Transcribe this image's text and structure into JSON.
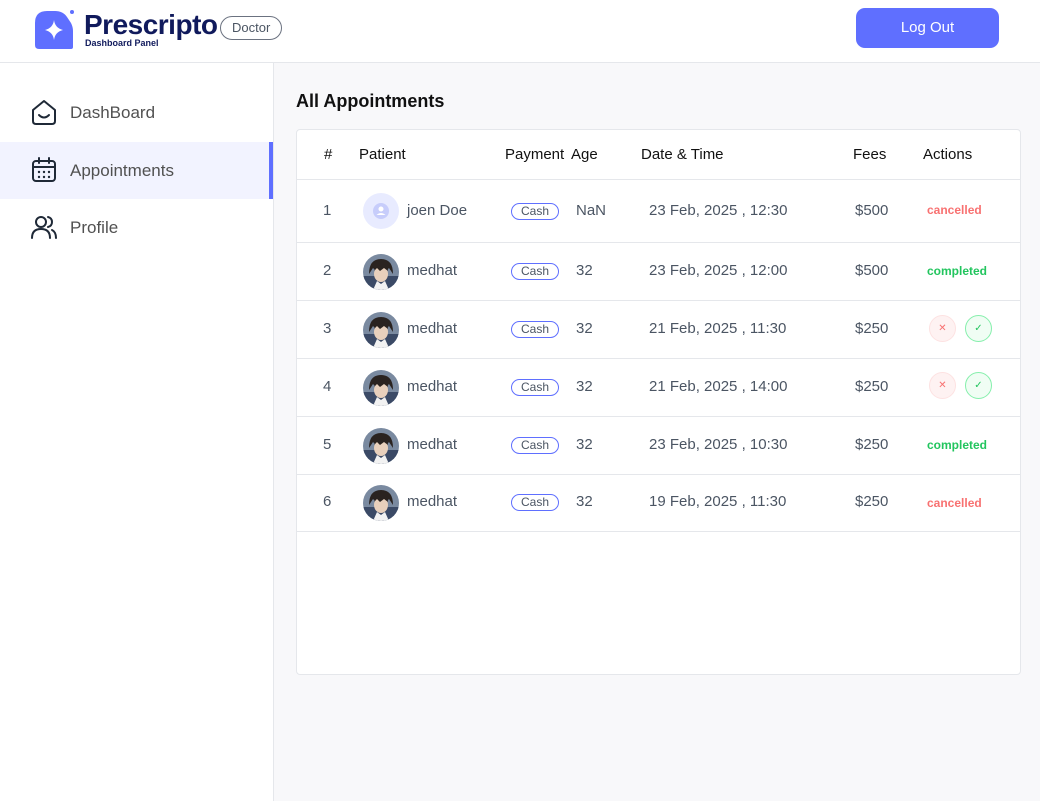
{
  "brand": {
    "name": "Prescripto",
    "subtitle": "Dashboard Panel",
    "role": "Doctor"
  },
  "header": {
    "logout_label": "Log Out"
  },
  "sidebar": {
    "items": [
      {
        "label": "DashBoard",
        "icon": "home-icon",
        "active": false
      },
      {
        "label": "Appointments",
        "icon": "calendar-icon",
        "active": true
      },
      {
        "label": "Profile",
        "icon": "people-icon",
        "active": false
      }
    ]
  },
  "main": {
    "title": "All Appointments",
    "table": {
      "columns": [
        "#",
        "Patient",
        "Payment",
        "Age",
        "Date & Time",
        "Fees",
        "Actions"
      ],
      "rows": [
        {
          "num": "1",
          "patient": "joen Doe",
          "avatar": "placeholder",
          "payment": "Cash",
          "age": "NaN",
          "datetime": "23 Feb, 2025 , 12:30",
          "fees": "$500",
          "status": "cancelled"
        },
        {
          "num": "2",
          "patient": "medhat",
          "avatar": "photo",
          "payment": "Cash",
          "age": "32",
          "datetime": "23 Feb, 2025 , 12:00",
          "fees": "$500",
          "status": "completed"
        },
        {
          "num": "3",
          "patient": "medhat",
          "avatar": "photo",
          "payment": "Cash",
          "age": "32",
          "datetime": "21 Feb, 2025 , 11:30",
          "fees": "$250",
          "status": "pending"
        },
        {
          "num": "4",
          "patient": "medhat",
          "avatar": "photo",
          "payment": "Cash",
          "age": "32",
          "datetime": "21 Feb, 2025 , 14:00",
          "fees": "$250",
          "status": "pending"
        },
        {
          "num": "5",
          "patient": "medhat",
          "avatar": "photo",
          "payment": "Cash",
          "age": "32",
          "datetime": "23 Feb, 2025 , 10:30",
          "fees": "$250",
          "status": "completed"
        },
        {
          "num": "6",
          "patient": "medhat",
          "avatar": "photo",
          "payment": "Cash",
          "age": "32",
          "datetime": "19 Feb, 2025 , 11:30",
          "fees": "$250",
          "status": "cancelled"
        }
      ],
      "status_labels": {
        "cancelled": "cancelled",
        "completed": "completed"
      }
    }
  },
  "colors": {
    "primary": "#5f6fff",
    "cancelled": "#f87171",
    "completed": "#22c55e",
    "brand_text": "#101a5c"
  }
}
